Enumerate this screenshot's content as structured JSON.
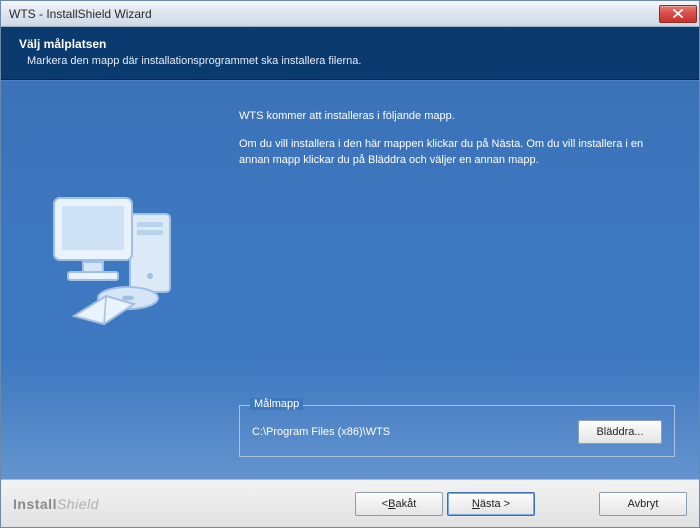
{
  "window": {
    "title": "WTS - InstallShield Wizard"
  },
  "header": {
    "heading": "Välj målplatsen",
    "subheading": "Markera den mapp där installationsprogrammet ska installera filerna."
  },
  "body": {
    "line1": "WTS kommer att installeras i följande mapp.",
    "line2": "Om du vill installera i den här mappen klickar du på  Nästa. Om du vill installera i en annan mapp klickar du på  Bläddra och väljer en annan mapp."
  },
  "target": {
    "legend": "Målmapp",
    "path": "C:\\Program Files (x86)\\WTS",
    "browse": "Bläddra..."
  },
  "footer": {
    "brand_bold": "Install",
    "brand_light": "Shield",
    "back_prefix": "< ",
    "back_u": "B",
    "back_rest": "akåt",
    "next_u": "N",
    "next_rest": "ästa >",
    "cancel": "Avbryt"
  }
}
